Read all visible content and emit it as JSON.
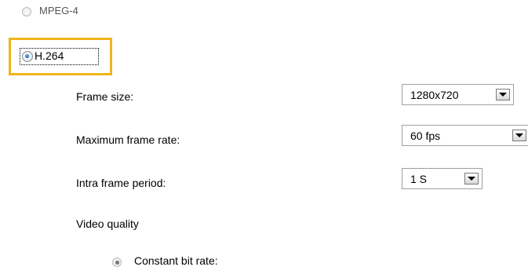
{
  "codecs": [
    {
      "label": "MPEG-4",
      "checked": false
    },
    {
      "label": "H.264",
      "checked": true
    }
  ],
  "settings": {
    "frame_size": {
      "label": "Frame size:",
      "value": "1280x720"
    },
    "max_frame_rate": {
      "label": "Maximum frame rate:",
      "value": "60 fps"
    },
    "intra_frame_period": {
      "label": "Intra frame period:",
      "value": "1 S"
    },
    "video_quality": {
      "label": "Video quality"
    },
    "constant_bit_rate": {
      "label": "Constant bit rate:",
      "checked": true
    }
  },
  "colors": {
    "highlight": "#f0b41c",
    "radio_selected": "#1e6bb5"
  }
}
